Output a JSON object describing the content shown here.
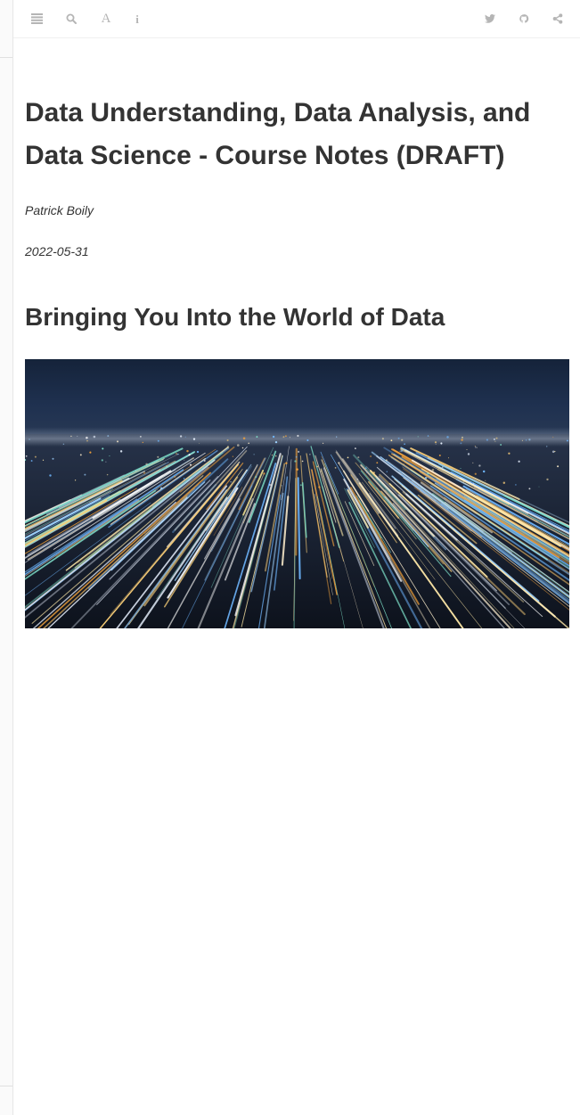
{
  "toolbar": {
    "left_buttons": [
      {
        "icon": "menu-icon",
        "label": "Toggle Sidebar"
      },
      {
        "icon": "search-icon",
        "label": "Search"
      },
      {
        "icon": "font-settings-icon",
        "glyph": "A",
        "label": "Font Settings"
      },
      {
        "icon": "info-icon",
        "glyph": "i",
        "label": "Information"
      }
    ],
    "right_buttons": [
      {
        "icon": "twitter-icon",
        "label": "Twitter"
      },
      {
        "icon": "github-icon",
        "label": "GitHub"
      },
      {
        "icon": "share-icon",
        "label": "Share"
      }
    ],
    "icon_color": "#b5b5b5"
  },
  "book": {
    "title": "Data Understanding, Data Analysis, and Data Science - Course Notes (DRAFT)",
    "author": "Patrick Boily",
    "date": "2022-05-31"
  },
  "section": {
    "heading": "Bringing You Into the World of Data",
    "image": "city-lights-zoom-image"
  },
  "colors": {
    "text": "#333333",
    "background": "#ffffff",
    "sky": "#1c2c47"
  }
}
